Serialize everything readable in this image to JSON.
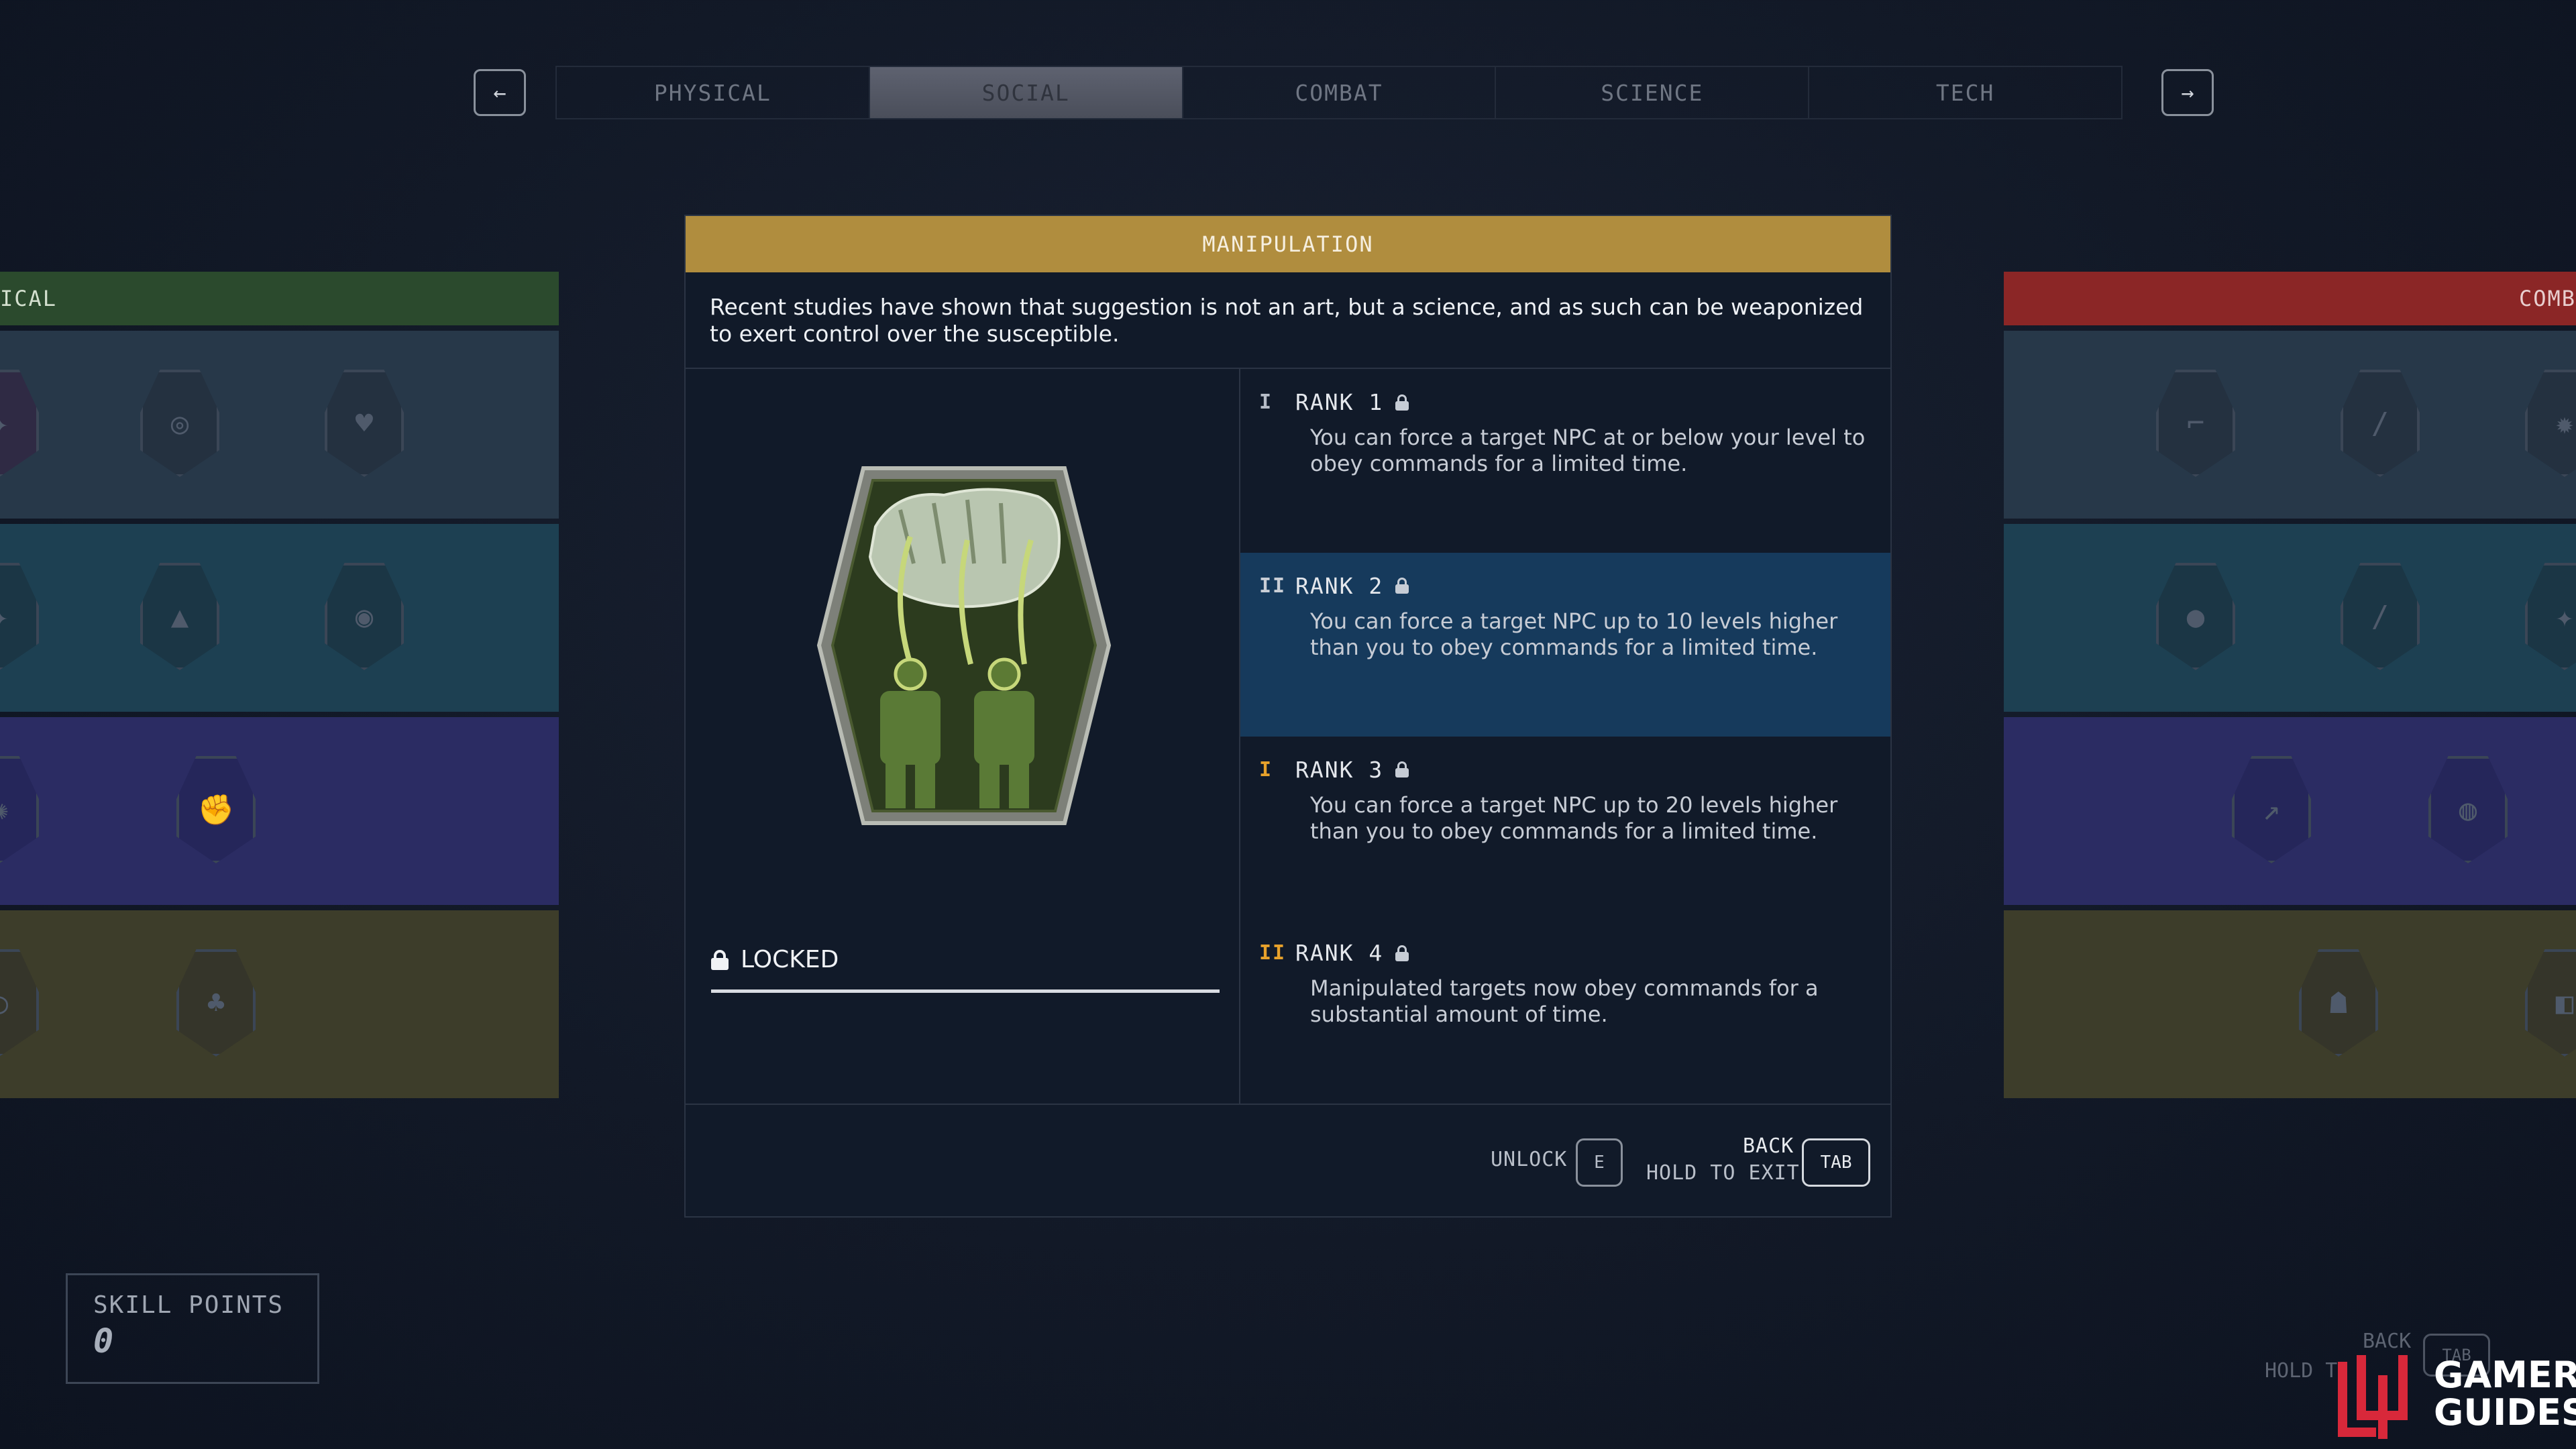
{
  "tabs": {
    "prev_arrow": "←",
    "next_arrow": "→",
    "items": [
      "PHYSICAL",
      "SOCIAL",
      "COMBAT",
      "SCIENCE",
      "TECH"
    ],
    "active": "SOCIAL"
  },
  "left_panel": {
    "label": "ICAL",
    "color": "#2b4a2d"
  },
  "right_panel": {
    "label": "COMB",
    "color": "#8b2626"
  },
  "modal": {
    "title": "MANIPULATION",
    "description": "Recent studies have shown that suggestion is not an art, but a science, and as such can be weaponized to exert control over the susceptible.",
    "status": "LOCKED",
    "ranks": [
      {
        "label": "RANK 1",
        "mark": "I",
        "text": "You can force a target NPC at or below your level to obey commands for a limited time."
      },
      {
        "label": "RANK 2",
        "mark": "II",
        "text": "You can force a target NPC up to 10 levels higher than you to obey commands for a limited time."
      },
      {
        "label": "RANK 3",
        "mark": "I",
        "text": "You can force a target NPC up to 20 levels higher than you to obey commands for a limited time."
      },
      {
        "label": "RANK 4",
        "mark": "II",
        "text": "Manipulated targets now obey commands for a substantial amount of time."
      }
    ],
    "footer": {
      "unlock_label": "UNLOCK",
      "unlock_key": "E",
      "back_label": "BACK",
      "hold_label": "HOLD TO EXIT",
      "back_key": "TAB"
    }
  },
  "skill_points": {
    "label": "SKILL POINTS",
    "value": "0"
  },
  "background_hints": {
    "back": "BACK",
    "hold": "HOLD T",
    "key": "TAB"
  },
  "watermark": {
    "line1": "GAMER",
    "line2": "GUIDES"
  }
}
